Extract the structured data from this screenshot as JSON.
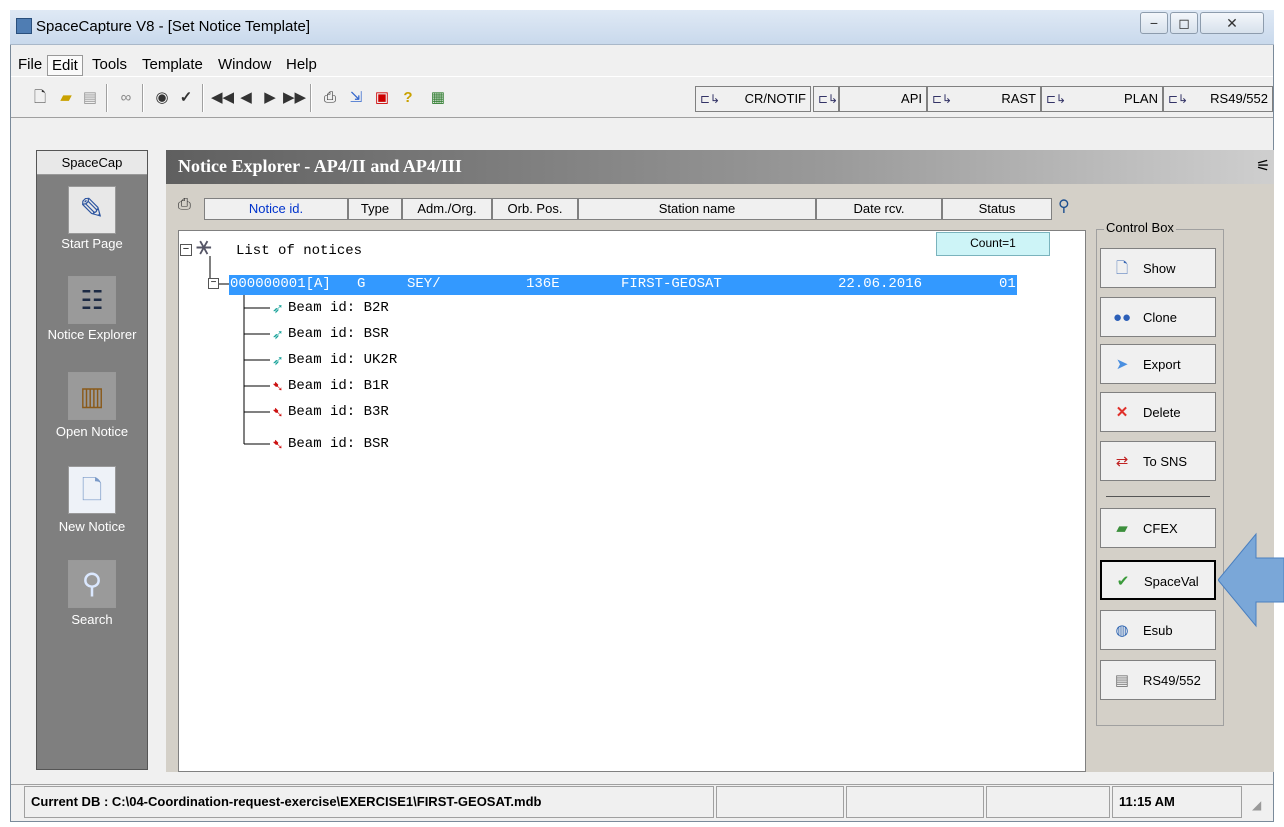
{
  "window": {
    "title": "SpaceCapture V8 - [Set Notice Template]",
    "controls": {
      "minimize": "−",
      "maximize": "◻",
      "close": "✕"
    }
  },
  "menu": [
    "File",
    "Edit",
    "Tools",
    "Template",
    "Window",
    "Help"
  ],
  "menu_active": "Edit",
  "toolbar": {
    "buttons": [
      "new-icon",
      "open-folder-icon",
      "database-icon",
      "glasses-icon",
      "binoculars-icon",
      "checkmark-icon",
      "first-record-icon",
      "previous-record-icon",
      "next-record-icon",
      "last-record-icon",
      "print-icon",
      "import-icon",
      "validate-icon",
      "help-icon",
      "layout-icon"
    ],
    "layer_tabs": [
      "CR/NOTIF",
      "",
      "API",
      "RAST",
      "PLAN",
      "RS49/552"
    ]
  },
  "sidebar": {
    "header": "SpaceCap",
    "items": [
      {
        "label": "Start Page",
        "icon": "start-page-icon"
      },
      {
        "label": "Notice Explorer",
        "icon": "notice-explorer-icon"
      },
      {
        "label": "Open Notice",
        "icon": "open-book-icon"
      },
      {
        "label": "New Notice",
        "icon": "new-document-icon"
      },
      {
        "label": "Search",
        "icon": "magnifier-icon"
      }
    ]
  },
  "panel": {
    "title": "Notice Explorer - AP4/II and AP4/III",
    "columns": [
      "Notice id.",
      "Type",
      "Adm./Org.",
      "Orb. Pos.",
      "Station name",
      "Date rcv.",
      "Status"
    ],
    "count": "Count=1",
    "root_label": "List of notices",
    "notice": {
      "id": "000000001[A]",
      "type": "G",
      "adm": "SEY/",
      "orb_pos": "136E",
      "station": "FIRST-GEOSAT",
      "date": "22.06.2016",
      "status": "01"
    },
    "beams": [
      {
        "label": "Beam id: B2R",
        "kind": "uplink"
      },
      {
        "label": "Beam id: BSR",
        "kind": "uplink"
      },
      {
        "label": "Beam id: UK2R",
        "kind": "uplink"
      },
      {
        "label": "Beam id: B1R",
        "kind": "downlink"
      },
      {
        "label": "Beam id: B3R",
        "kind": "downlink"
      },
      {
        "label": "Beam id: BSR",
        "kind": "downlink"
      }
    ]
  },
  "control_box": {
    "label": "Control Box",
    "buttons": [
      {
        "label": "Show",
        "icon": "document-icon"
      },
      {
        "label": "Clone",
        "icon": "users-icon"
      },
      {
        "label": "Export",
        "icon": "export-arrow-icon"
      },
      {
        "label": "Delete",
        "icon": "delete-x-icon"
      },
      {
        "label": "To SNS",
        "icon": "sns-transfer-icon"
      },
      {
        "label": "CFEX",
        "icon": "cfex-folder-icon"
      },
      {
        "label": "SpaceVal",
        "icon": "spaceval-check-icon"
      },
      {
        "label": "Esub",
        "icon": "esub-globe-icon"
      },
      {
        "label": "RS49/552",
        "icon": "rs49-database-icon"
      }
    ]
  },
  "status": {
    "db": "Current DB : C:\\04-Coordination-request-exercise\\EXERCISE1\\FIRST-GEOSAT.mdb",
    "time": "11:15 AM"
  },
  "colors": {
    "selection": "#3399ff",
    "arrow": "#7aa7d8",
    "count_bg": "#cdf4f7"
  }
}
